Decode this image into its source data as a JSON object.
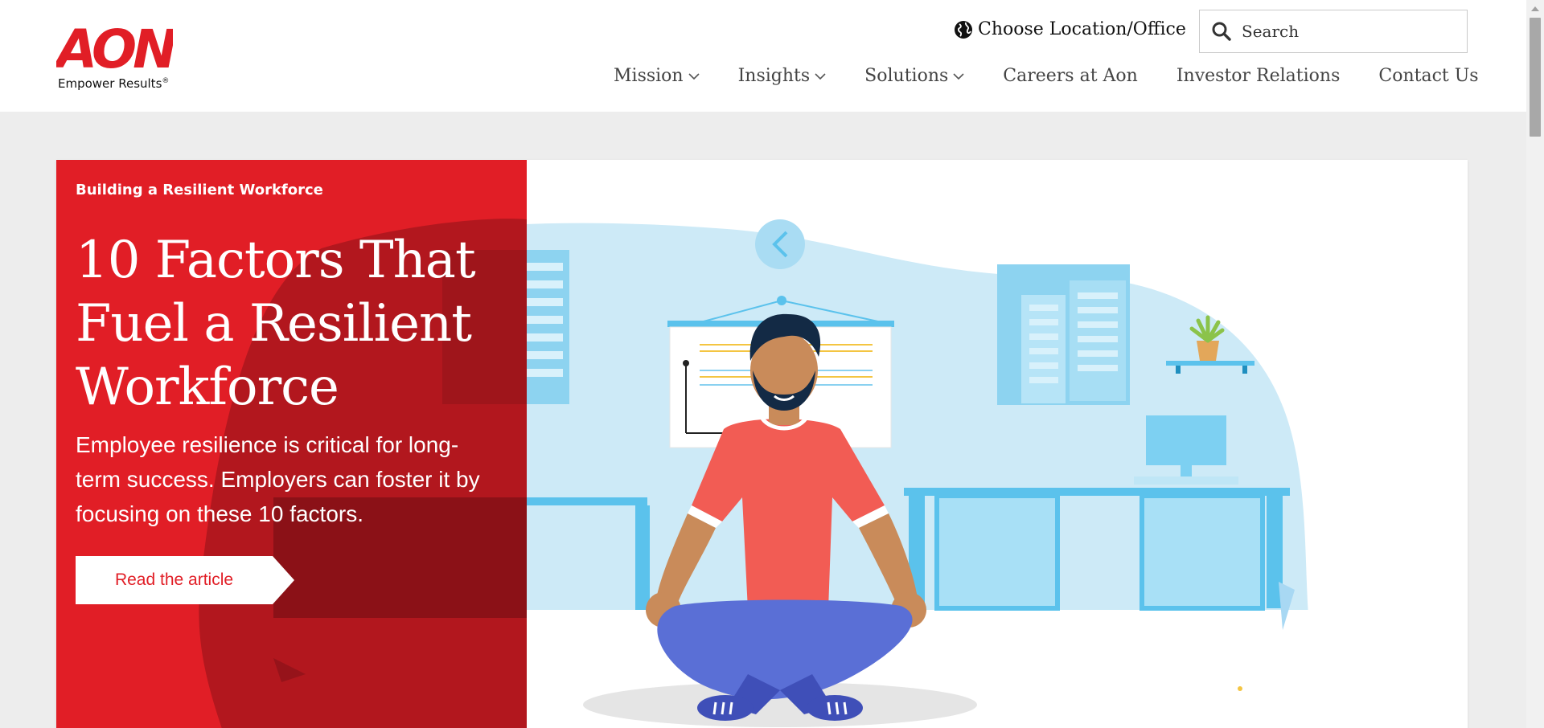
{
  "brand": {
    "logo_text": "AON",
    "tagline": "Empower Results",
    "tagline_mark": "®",
    "accent_color": "#e11e26"
  },
  "header": {
    "location_label": "Choose Location/Office",
    "location_icon": "globe-icon",
    "search": {
      "placeholder": "Search",
      "icon": "search-icon"
    }
  },
  "nav": {
    "items": [
      {
        "label": "Mission",
        "has_dropdown": true
      },
      {
        "label": "Insights",
        "has_dropdown": true
      },
      {
        "label": "Solutions",
        "has_dropdown": true
      },
      {
        "label": "Careers at Aon",
        "has_dropdown": false
      },
      {
        "label": "Investor Relations",
        "has_dropdown": false
      },
      {
        "label": "Contact Us",
        "has_dropdown": false
      }
    ]
  },
  "hero": {
    "eyebrow": "Building a Resilient Workforce",
    "headline": "10 Factors That Fuel a Resilient Workforce",
    "subtext": "Employee resilience is critical for long-term success. Employers can foster it by focusing on these 10 factors.",
    "cta_label": "Read the article",
    "panel_color": "#e11e26",
    "carousel_prev_icon": "chevron-left-icon"
  }
}
